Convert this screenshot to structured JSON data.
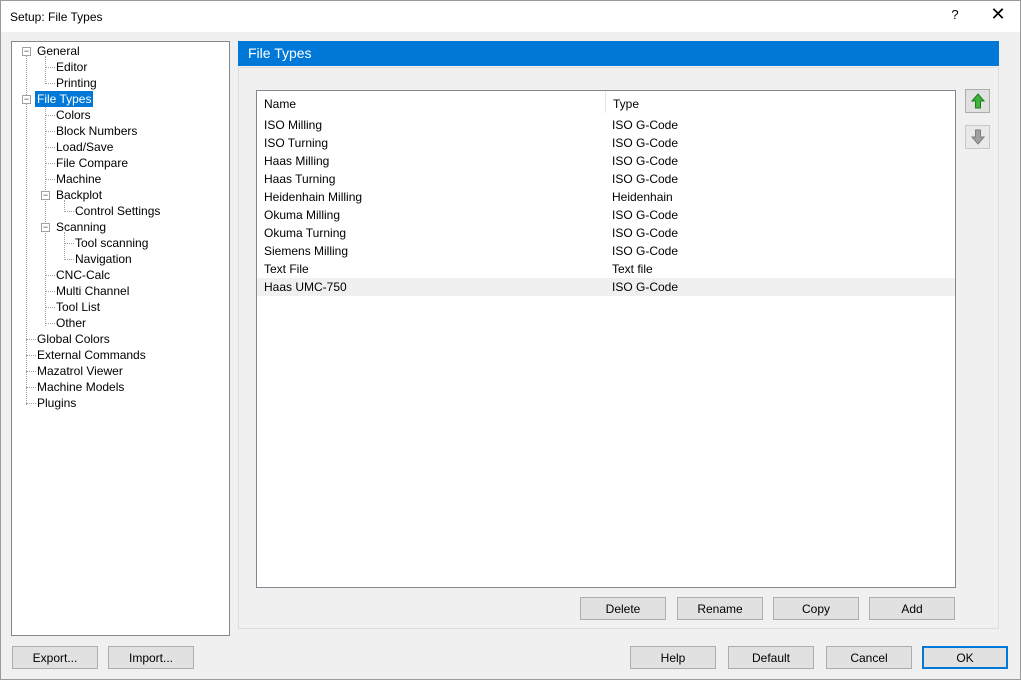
{
  "window": {
    "title": "Setup: File Types",
    "help_glyph": "?",
    "close_glyph": "✕"
  },
  "tree": {
    "general": "General",
    "editor": "Editor",
    "printing": "Printing",
    "file_types": "File Types",
    "colors": "Colors",
    "block_numbers": "Block Numbers",
    "load_save": "Load/Save",
    "file_compare": "File Compare",
    "machine": "Machine",
    "backplot": "Backplot",
    "control_settings": "Control Settings",
    "scanning": "Scanning",
    "tool_scanning": "Tool scanning",
    "navigation": "Navigation",
    "cnc_calc": "CNC-Calc",
    "multi_channel": "Multi Channel",
    "tool_list": "Tool List",
    "other": "Other",
    "global_colors": "Global Colors",
    "external_commands": "External Commands",
    "mazatrol_viewer": "Mazatrol Viewer",
    "machine_models": "Machine Models",
    "plugins": "Plugins"
  },
  "header": {
    "title": "File Types"
  },
  "list": {
    "columns": {
      "name": "Name",
      "type": "Type"
    },
    "rows": [
      {
        "name": "ISO Milling",
        "type": "ISO G-Code"
      },
      {
        "name": "ISO Turning",
        "type": "ISO G-Code"
      },
      {
        "name": "Haas Milling",
        "type": "ISO G-Code"
      },
      {
        "name": "Haas Turning",
        "type": "ISO G-Code"
      },
      {
        "name": "Heidenhain Milling",
        "type": "Heidenhain"
      },
      {
        "name": "Okuma Milling",
        "type": "ISO G-Code"
      },
      {
        "name": "Okuma Turning",
        "type": "ISO G-Code"
      },
      {
        "name": "Siemens Milling",
        "type": "ISO G-Code"
      },
      {
        "name": "Text File",
        "type": "Text file"
      },
      {
        "name": "Haas UMC-750",
        "type": "ISO G-Code"
      }
    ]
  },
  "list_buttons": {
    "delete": "Delete",
    "rename": "Rename",
    "copy": "Copy",
    "add": "Add"
  },
  "footer": {
    "export": "Export...",
    "import": "Import...",
    "help": "Help",
    "default": "Default",
    "cancel": "Cancel",
    "ok": "OK"
  },
  "colors": {
    "accent": "#0078d7",
    "arrow_up": "#3cb43c",
    "arrow_down": "#a0a0a0"
  }
}
